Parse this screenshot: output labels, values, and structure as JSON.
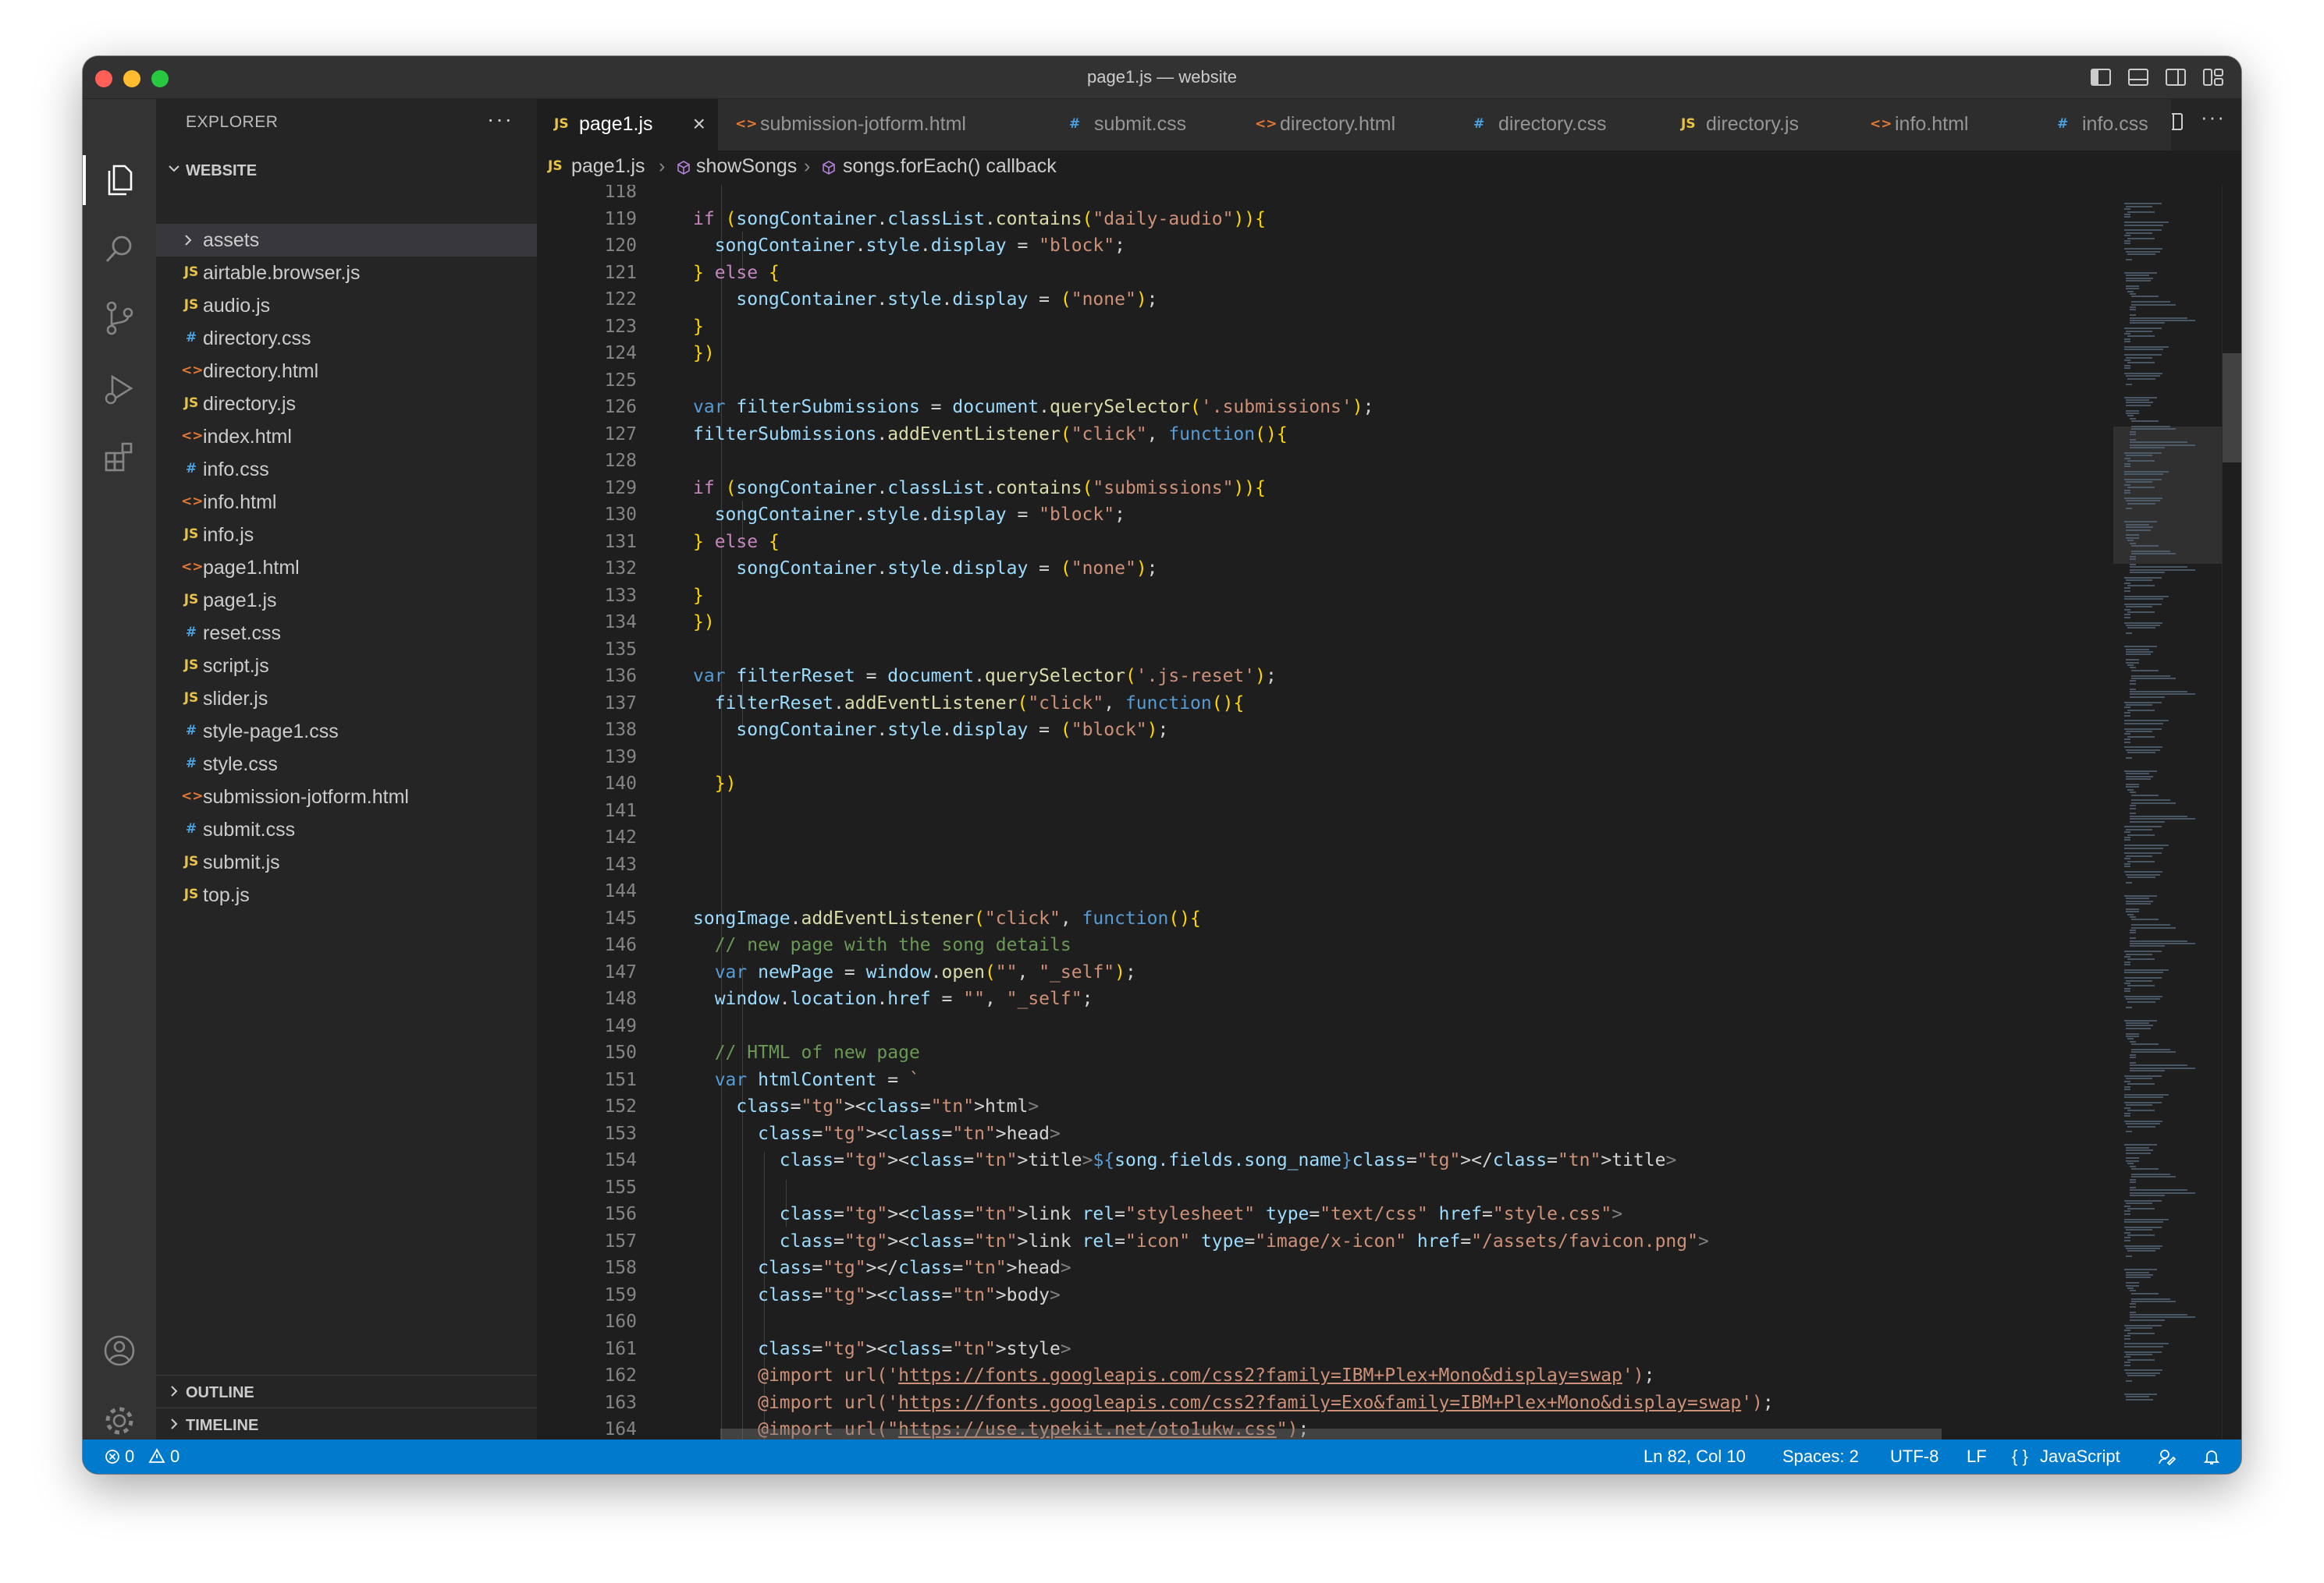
{
  "window": {
    "title": "page1.js — website"
  },
  "explorer": {
    "title": "EXPLORER",
    "more": "···",
    "folder": "WEBSITE",
    "items": [
      {
        "name": "assets",
        "type": "folder"
      },
      {
        "name": "airtable.browser.js",
        "type": "js"
      },
      {
        "name": "audio.js",
        "type": "js"
      },
      {
        "name": "directory.css",
        "type": "css"
      },
      {
        "name": "directory.html",
        "type": "html"
      },
      {
        "name": "directory.js",
        "type": "js"
      },
      {
        "name": "index.html",
        "type": "html"
      },
      {
        "name": "info.css",
        "type": "css"
      },
      {
        "name": "info.html",
        "type": "html"
      },
      {
        "name": "info.js",
        "type": "js"
      },
      {
        "name": "page1.html",
        "type": "html"
      },
      {
        "name": "page1.js",
        "type": "js"
      },
      {
        "name": "reset.css",
        "type": "css"
      },
      {
        "name": "script.js",
        "type": "js"
      },
      {
        "name": "slider.js",
        "type": "js"
      },
      {
        "name": "style-page1.css",
        "type": "css"
      },
      {
        "name": "style.css",
        "type": "css"
      },
      {
        "name": "submission-jotform.html",
        "type": "html"
      },
      {
        "name": "submit.css",
        "type": "css"
      },
      {
        "name": "submit.js",
        "type": "js"
      },
      {
        "name": "top.js",
        "type": "js"
      }
    ],
    "outline": "OUTLINE",
    "timeline": "TIMELINE"
  },
  "icons": {
    "js": "JS",
    "css": "#",
    "html": "<>"
  },
  "tabs": [
    {
      "label": "page1.js",
      "type": "js",
      "active": true,
      "close": "×"
    },
    {
      "label": "submission-jotform.html",
      "type": "html"
    },
    {
      "label": "submit.css",
      "type": "css"
    },
    {
      "label": "directory.html",
      "type": "html"
    },
    {
      "label": "directory.css",
      "type": "css"
    },
    {
      "label": "directory.js",
      "type": "js"
    },
    {
      "label": "info.html",
      "type": "html"
    },
    {
      "label": "info.css",
      "type": "css"
    }
  ],
  "breadcrumbs": {
    "file": "page1.js",
    "fn": "showSongs",
    "callback": "songs.forEach() callback"
  },
  "code": {
    "line_numbers": [
      "118",
      "119",
      "120",
      "121",
      "122",
      "123",
      "124",
      "125",
      "126",
      "127",
      "128",
      "129",
      "130",
      "131",
      "132",
      "133",
      "134",
      "135",
      "136",
      "137",
      "138",
      "139",
      "140",
      "141",
      "142",
      "143",
      "144",
      "145",
      "146",
      "147",
      "148",
      "149",
      "150",
      "151",
      "152",
      "153",
      "154",
      "155",
      "156",
      "157",
      "158",
      "159",
      "160",
      "161",
      "162",
      "163",
      "164"
    ],
    "lines": [
      "",
      "if (songContainer.classList.contains(\"daily-audio\")){",
      "  songContainer.style.display = \"block\";",
      "} else {",
      "    songContainer.style.display = (\"none\");",
      "}",
      "})",
      "",
      "var filterSubmissions = document.querySelector('.submissions');",
      "filterSubmissions.addEventListener(\"click\", function(){",
      "",
      "if (songContainer.classList.contains(\"submissions\")){",
      "  songContainer.style.display = \"block\";",
      "} else {",
      "    songContainer.style.display = (\"none\");",
      "}",
      "})",
      "",
      "var filterReset = document.querySelector('.js-reset');",
      "  filterReset.addEventListener(\"click\", function(){",
      "    songContainer.style.display = (\"block\");",
      "",
      "  })",
      "",
      "",
      "",
      "",
      "songImage.addEventListener(\"click\", function(){",
      "  // new page with the song details",
      "  var newPage = window.open(\"\", \"_self\");",
      "  window.location.href = \"\", \"_self\";",
      "",
      "  // HTML of new page",
      "  var htmlContent = `",
      "    <html>",
      "      <head>",
      "        <title>${song.fields.song_name}</title>",
      "",
      "        <link rel=\"stylesheet\" type=\"text/css\" href=\"style.css\">",
      "        <link rel=\"icon\" type=\"image/x-icon\" href=\"/assets/favicon.png\">",
      "      </head>",
      "      <body>",
      "",
      "      <style>",
      "      @import url('https://fonts.googleapis.com/css2?family=IBM+Plex+Mono&display=swap');",
      "      @import url('https://fonts.googleapis.com/css2?family=Exo&family=IBM+Plex+Mono&display=swap');",
      "      @import url(\"https://use.typekit.net/oto1ukw.css\");"
    ]
  },
  "status": {
    "errors": "0",
    "warnings": "0",
    "position": "Ln 82, Col 10",
    "spaces": "Spaces: 2",
    "encoding": "UTF-8",
    "eol": "LF",
    "language": "JavaScript"
  },
  "colors": {
    "statusbar": "#007acc",
    "editor_bg": "#1e1e1e",
    "sidebar_bg": "#252526",
    "activitybar_bg": "#333333"
  }
}
